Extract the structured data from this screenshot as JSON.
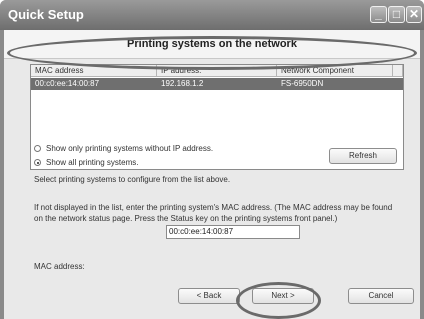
{
  "window": {
    "title": "Quick Setup"
  },
  "header": {
    "title": "Printing systems on the network"
  },
  "list": {
    "columns": [
      "MAC address",
      "IP address:",
      "Network Component"
    ],
    "rows": [
      {
        "mac": "00:c0:ee:14:00:87",
        "ip": "192.168.1.2",
        "component": "FS-6950DN"
      }
    ]
  },
  "filter": {
    "option_without_ip": "Show only printing systems without IP address.",
    "option_all": "Show all printing systems.",
    "selected": "all"
  },
  "refresh_label": "Refresh",
  "instructions": {
    "select_text": "Select printing systems to configure from the list above.",
    "manual_text_line1": "If not displayed in the list, enter the printing system's MAC address. (The MAC address may be found",
    "manual_text_line2": "on the network status page. Press the Status key on the printing systems front panel.)"
  },
  "mac_field": {
    "label": "MAC address:",
    "value": "00:c0:ee:14:00:87"
  },
  "buttons": {
    "back": "< Back",
    "next": "Next >",
    "cancel": "Cancel"
  },
  "colors": {
    "title_bar": "#7a7a7a",
    "selected_row": "#6f6f6f",
    "highlight_ellipse": "#6a6a6a"
  }
}
